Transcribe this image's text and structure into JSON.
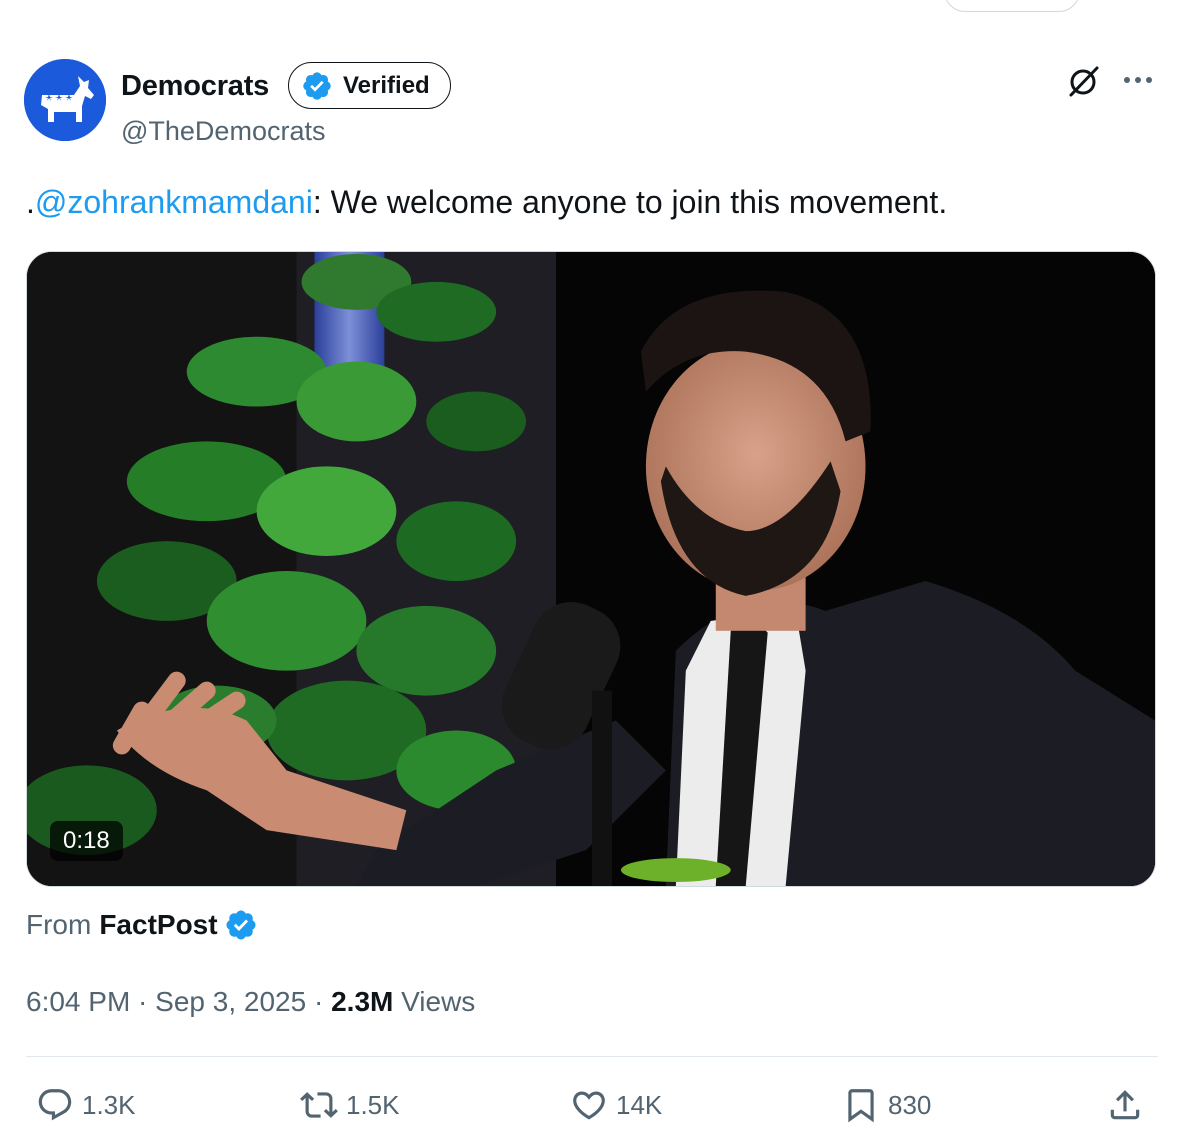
{
  "author": {
    "name": "Democrats",
    "handle": "@TheDemocrats",
    "badge_label": "Verified"
  },
  "tweet": {
    "prefix": ".",
    "mention": "@zohrankmamdani",
    "text": ": We welcome anyone to join this movement."
  },
  "media": {
    "duration": "0:18"
  },
  "source": {
    "from_label": "From",
    "name": "FactPost"
  },
  "meta": {
    "time": "6:04 PM",
    "separator1": " · ",
    "date": "Sep 3, 2025",
    "separator2": " · ",
    "views_count": "2.3M",
    "views_label": " Views"
  },
  "actions": {
    "replies": "1.3K",
    "reposts": "1.5K",
    "likes": "14K",
    "bookmarks": "830"
  },
  "colors": {
    "link": "#1d9bf0",
    "verified": "#1d9bf0",
    "muted": "#536471",
    "avatar_bg": "#1a5adb"
  },
  "icons": {
    "avatar": "democrats-donkey-logo",
    "verified": "verified-badge-icon",
    "grok": "grok-icon",
    "more": "more-icon",
    "reply": "reply-icon",
    "repost": "repost-icon",
    "like": "heart-icon",
    "bookmark": "bookmark-icon",
    "share": "share-icon"
  }
}
